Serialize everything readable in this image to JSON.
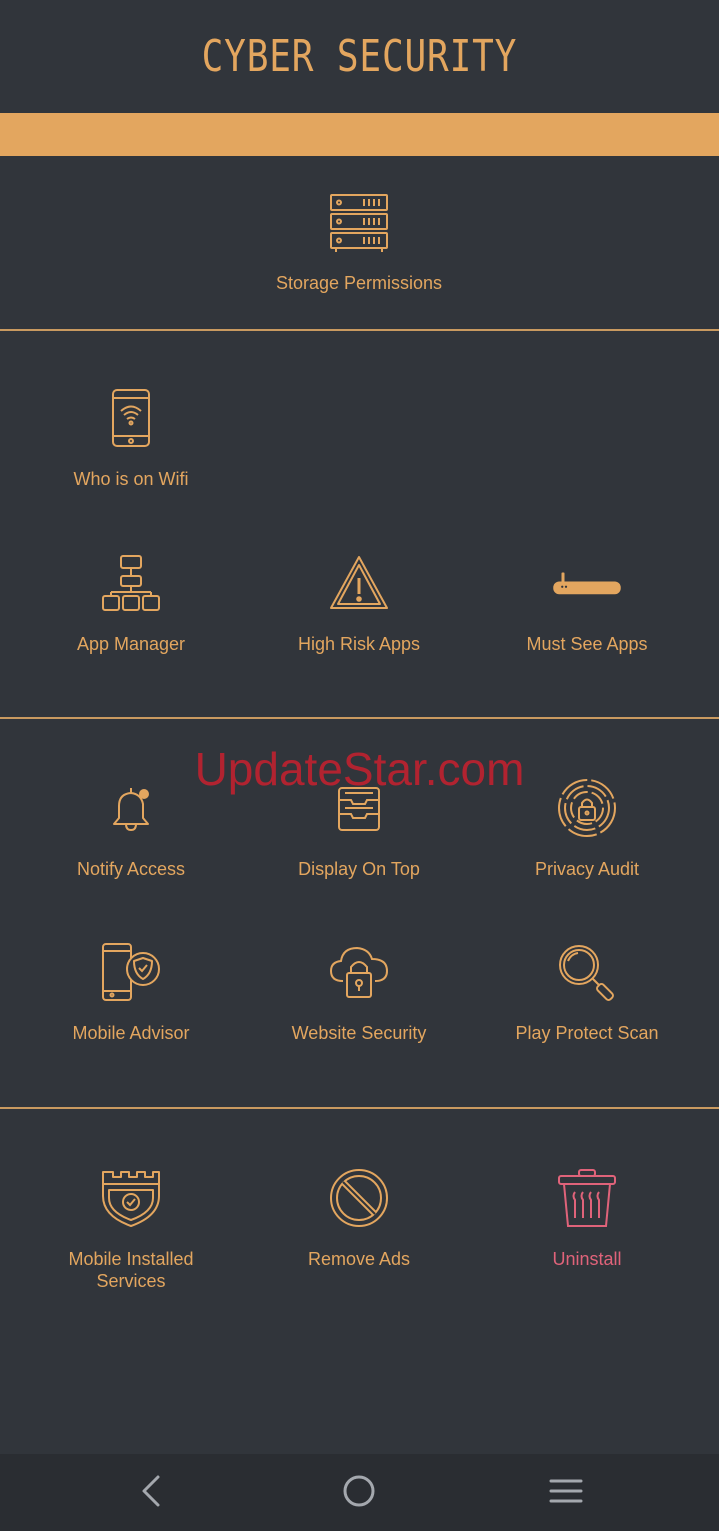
{
  "header": {
    "title": "CYBER SECURITY"
  },
  "colors": {
    "accent": "#e3a65f",
    "background": "#31353b",
    "danger": "#e0637a",
    "navbar": "#2a2d32"
  },
  "watermark": "UpdateStar.com",
  "sections": [
    {
      "items": [
        {
          "label": "Storage Permissions",
          "icon": "server-rack-icon"
        }
      ]
    },
    {
      "items": [
        {
          "label": "Who is on Wifi",
          "icon": "phone-wifi-icon"
        },
        {
          "label": "App Manager",
          "icon": "hierarchy-icon"
        },
        {
          "label": "High Risk Apps",
          "icon": "warning-triangle-icon"
        },
        {
          "label": "Must See Apps",
          "icon": "router-icon"
        }
      ]
    },
    {
      "items": [
        {
          "label": "Notify Access",
          "icon": "bell-icon"
        },
        {
          "label": "Display On Top",
          "icon": "stacked-trays-icon"
        },
        {
          "label": "Privacy Audit",
          "icon": "fingerprint-lock-icon"
        },
        {
          "label": "Mobile Advisor",
          "icon": "phone-shield-icon"
        },
        {
          "label": "Website Security",
          "icon": "cloud-lock-icon"
        },
        {
          "label": "Play Protect Scan",
          "icon": "magnifier-icon"
        }
      ]
    },
    {
      "items": [
        {
          "label": "Mobile Installed\nServices",
          "icon": "castle-shield-icon"
        },
        {
          "label": "Remove Ads",
          "icon": "no-sign-icon"
        },
        {
          "label": "Uninstall",
          "icon": "trash-icon"
        }
      ]
    }
  ],
  "navbar": {
    "back": "back-icon",
    "home": "home-icon",
    "menu": "menu-icon"
  }
}
